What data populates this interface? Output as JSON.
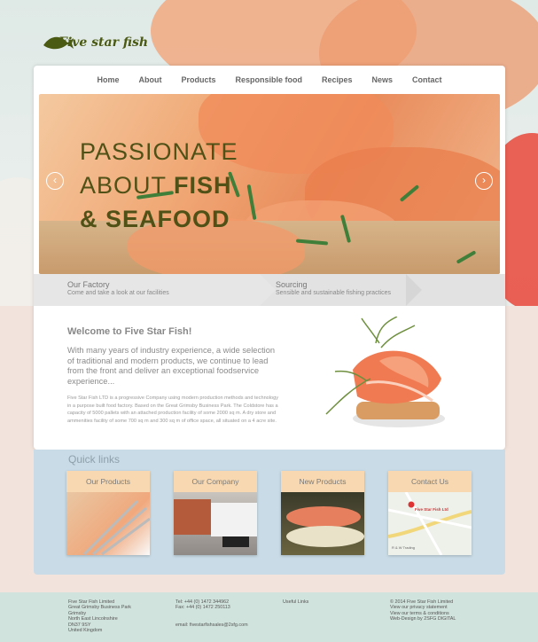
{
  "brand": {
    "logo_text": "Five star fish",
    "accent": "#4a5a12"
  },
  "nav": {
    "items": [
      "Home",
      "About",
      "Products",
      "Responsible food",
      "Recipes",
      "News",
      "Contact"
    ]
  },
  "slider": {
    "line1": "PASSIONATE",
    "line2_a": "ABOUT",
    "line2_b": "FISH",
    "line3": "& SEAFOOD",
    "prev_icon": "chevron-left-icon",
    "next_icon": "chevron-right-icon"
  },
  "tabs": [
    {
      "title": "Our Factory",
      "subtitle": "Come and take a look at our facilities"
    },
    {
      "title": "Sourcing",
      "subtitle": "Sensible and sustainable fishing practices"
    }
  ],
  "welcome": {
    "title": "Welcome to Five Star Fish!",
    "lead": "With many years of industry experience, a wide selection of traditional and modern products, we continue to lead from the front and deliver an exceptional foodservice experience...",
    "body": "Five Star Fish LTD is a progressive Company using modern production methods and technology in a purpose built food factory. Based on the Great Grimsby Business Park. The Coldstore has a capacity of 5000 pallets with an attached production facility of some 2000 sq m. A dry store and ammenities facility of some 700 sq m and 300 sq m of office space, all situated on a 4 acre site."
  },
  "quick_links": {
    "title": "Quick links",
    "cards": [
      "Our Products",
      "Our Company",
      "New Products",
      "Contact Us"
    ],
    "map_label": "Five Star Fish Ltd",
    "map_place": "R & W Trading"
  },
  "footer": {
    "address": [
      "Five Star Fish Limited",
      "Great Grimsby Business Park",
      "Grimsby",
      "North East Lincolnshire",
      "DN37 9SY",
      "United Kingdom"
    ],
    "tel": "Tel: +44 (0) 1472 344962",
    "fax": "Fax: +44 (0) 1472 250113",
    "email": "email: fivestarfishsales@2sfg.com",
    "useful_links": "Useful Links",
    "legal": [
      "© 2014 Five Star Fish Limited",
      "View our privacy statement",
      "View our terms & conditions",
      "Web-Design by 2SFG DIGITAL"
    ]
  }
}
